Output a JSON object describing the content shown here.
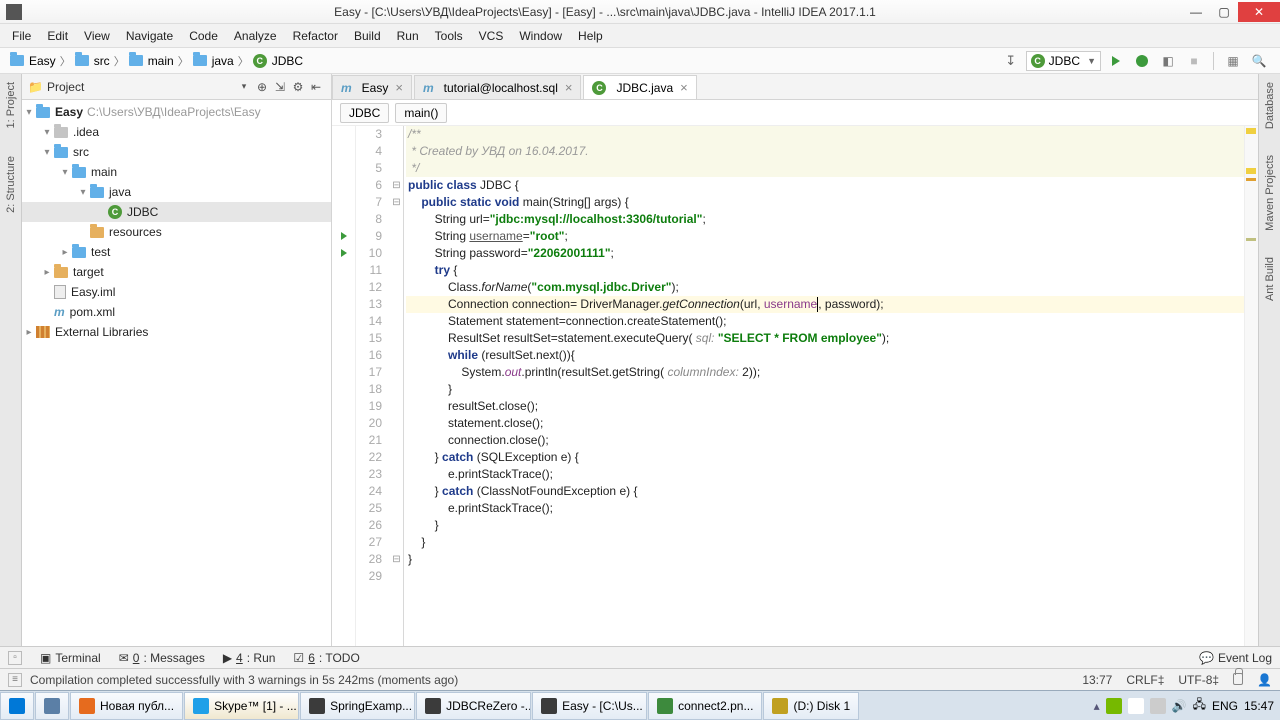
{
  "title": "Easy - [C:\\Users\\УВД\\IdeaProjects\\Easy] - [Easy] - ...\\src\\main\\java\\JDBC.java - IntelliJ IDEA 2017.1.1",
  "menu": [
    "File",
    "Edit",
    "View",
    "Navigate",
    "Code",
    "Analyze",
    "Refactor",
    "Build",
    "Run",
    "Tools",
    "VCS",
    "Window",
    "Help"
  ],
  "crumbs": [
    "Easy",
    "src",
    "main",
    "java",
    "JDBC"
  ],
  "run_config": "JDBC",
  "left_rail": [
    "1: Project",
    "2: Structure"
  ],
  "right_rail": [
    "Database",
    "Maven Projects",
    "Ant Build"
  ],
  "project": {
    "title": "Project",
    "root": {
      "name": "Easy",
      "hint": "C:\\Users\\УВД\\IdeaProjects\\Easy"
    },
    "nodes": [
      {
        "indent": 1,
        "twisty": "▾",
        "icon": "folder-grey",
        "label": ".idea"
      },
      {
        "indent": 1,
        "twisty": "▾",
        "icon": "folder-blue",
        "label": "src"
      },
      {
        "indent": 2,
        "twisty": "▾",
        "icon": "folder-blue",
        "label": "main"
      },
      {
        "indent": 3,
        "twisty": "▾",
        "icon": "folder-blue",
        "label": "java"
      },
      {
        "indent": 4,
        "twisty": "",
        "icon": "class",
        "label": "JDBC",
        "selected": true
      },
      {
        "indent": 3,
        "twisty": "",
        "icon": "folder-brown",
        "label": "resources"
      },
      {
        "indent": 2,
        "twisty": "▸",
        "icon": "folder-blue",
        "label": "test"
      },
      {
        "indent": 1,
        "twisty": "▸",
        "icon": "folder-brown",
        "label": "target"
      },
      {
        "indent": 1,
        "twisty": "",
        "icon": "file",
        "label": "Easy.iml"
      },
      {
        "indent": 1,
        "twisty": "",
        "icon": "m",
        "label": "pom.xml"
      }
    ],
    "ext_lib": "External Libraries"
  },
  "tabs": [
    {
      "icon": "m",
      "label": "Easy",
      "active": false
    },
    {
      "icon": "m",
      "label": "tutorial@localhost.sql",
      "active": false
    },
    {
      "icon": "class",
      "label": "JDBC.java",
      "active": true
    }
  ],
  "editor_crumbs": [
    "JDBC",
    "main()"
  ],
  "code": {
    "start": 3,
    "lines": [
      {
        "n": 3,
        "doc": true,
        "html": "<span class='com'>/**</span>"
      },
      {
        "n": 4,
        "doc": true,
        "html": "<span class='com'> * Created by УВД on 16.04.2017.</span>"
      },
      {
        "n": 5,
        "doc": true,
        "html": "<span class='com'> */</span>"
      },
      {
        "n": 6,
        "run": true,
        "fold": "⊟",
        "html": "<span class='kw'>public class</span> JDBC {"
      },
      {
        "n": 7,
        "run": true,
        "fold": "⊟",
        "html": "    <span class='kw'>public static void</span> main(String[] args) {"
      },
      {
        "n": 8,
        "html": "        String url=<span class='str'>\"jdbc:mysql://localhost:3306/tutorial\"</span>;"
      },
      {
        "n": 9,
        "html": "        String <span class='under'>username</span>=<span class='str'>\"root\"</span>;"
      },
      {
        "n": 10,
        "html": "        String password=<span class='str'>\"22062001111\"</span>;"
      },
      {
        "n": 11,
        "html": "        <span class='kw'>try</span> {"
      },
      {
        "n": 12,
        "html": "            Class.<span class='it'>forName</span>(<span class='str'>\"com.mysql.jdbc.Driver\"</span>);"
      },
      {
        "n": 13,
        "hl": true,
        "html": "            Connection connection= DriverManager.<span class='it'>getConnection</span>(url, <span class='purple'>username</span><span class='caret' style='position:static;display:inline-block;vertical-align:middle;'></span>, password);"
      },
      {
        "n": 14,
        "html": "            Statement statement=connection.createStatement();"
      },
      {
        "n": 15,
        "html": "            ResultSet resultSet=statement.executeQuery( <span class='param'>sql:</span> <span class='str'>\"SELECT * FROM employee\"</span>);"
      },
      {
        "n": 16,
        "html": "            <span class='kw'>while</span> (resultSet.next()){"
      },
      {
        "n": 17,
        "html": "                System.<span class='purple it'>out</span>.println(resultSet.getString( <span class='param'>columnIndex:</span> 2));"
      },
      {
        "n": 18,
        "html": "            }"
      },
      {
        "n": 19,
        "html": "            resultSet.close();"
      },
      {
        "n": 20,
        "html": "            statement.close();"
      },
      {
        "n": 21,
        "html": "            connection.close();"
      },
      {
        "n": 22,
        "html": "        } <span class='kw'>catch</span> (SQLException e) {"
      },
      {
        "n": 23,
        "html": "            e.printStackTrace();"
      },
      {
        "n": 24,
        "html": "        } <span class='kw'>catch</span> (ClassNotFoundException e) {"
      },
      {
        "n": 25,
        "html": "            e.printStackTrace();"
      },
      {
        "n": 26,
        "html": "        }"
      },
      {
        "n": 27,
        "html": "    }"
      },
      {
        "n": 28,
        "fold": "⊟",
        "html": "}"
      },
      {
        "n": 29,
        "html": ""
      }
    ]
  },
  "bottom_tools": [
    {
      "icon": "▣",
      "label": "Terminal"
    },
    {
      "icon": "✉",
      "num": "0",
      "label": ": Messages"
    },
    {
      "icon": "▶",
      "num": "4",
      "label": ": Run"
    },
    {
      "icon": "☑",
      "num": "6",
      "label": ": TODO"
    }
  ],
  "event_log": "Event Log",
  "status": {
    "msg": "Compilation completed successfully with 3 warnings in 5s 242ms (moments ago)",
    "pos": "13:77",
    "eol": "CRLF‡",
    "enc": "UTF-8‡"
  },
  "taskbar": [
    {
      "label": "",
      "icon": "#0078d7"
    },
    {
      "label": "",
      "icon": "#5b7fa6"
    },
    {
      "label": "Новая публ...",
      "icon": "#e66b1e"
    },
    {
      "label": "Skype™ [1] - ...",
      "icon": "#1fa0e8",
      "active": true
    },
    {
      "label": "SpringExamp...",
      "icon": "#3b3b3b"
    },
    {
      "label": "JDBCReZero -...",
      "icon": "#3b3b3b"
    },
    {
      "label": "Easy - [C:\\Us...",
      "icon": "#3b3b3b"
    },
    {
      "label": "connect2.pn...",
      "icon": "#3d8a3d"
    },
    {
      "label": "(D:) Disk 1",
      "icon": "#c0a020"
    }
  ],
  "tray": {
    "lang": "ENG",
    "time": "15:47"
  }
}
